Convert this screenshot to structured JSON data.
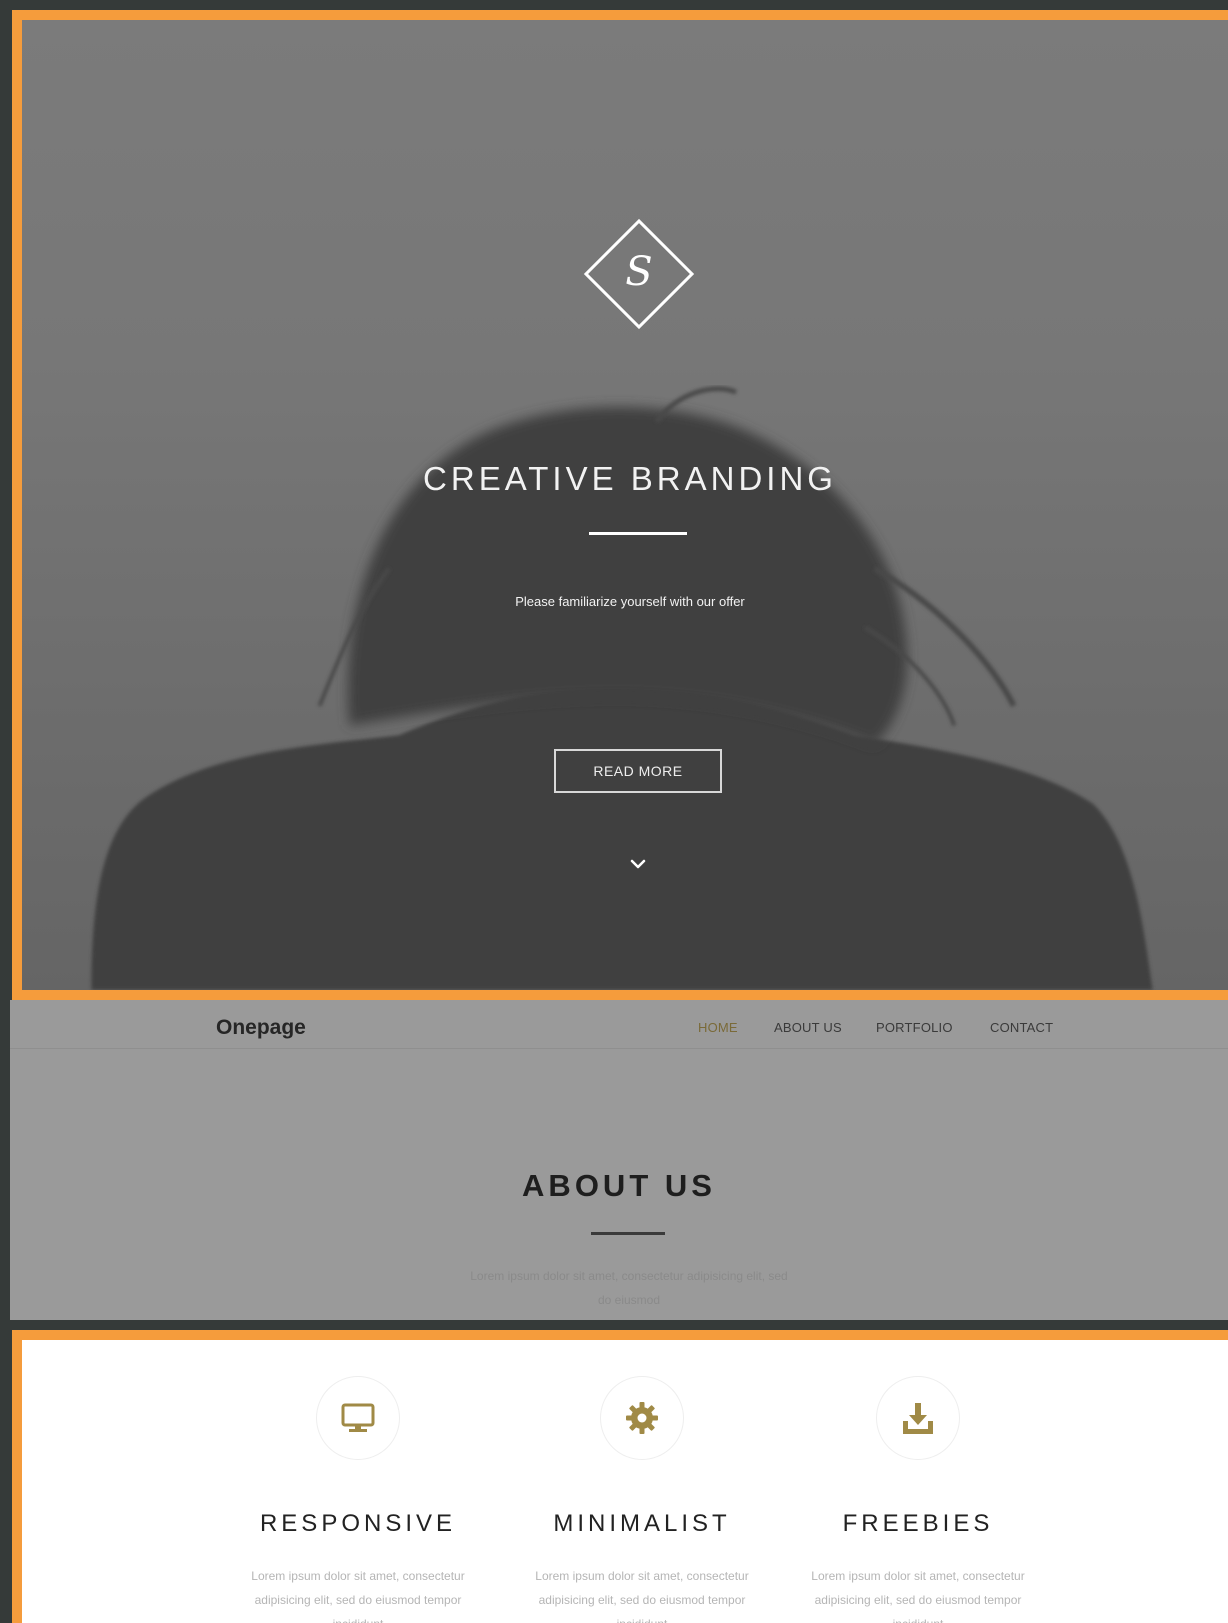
{
  "hero": {
    "logo_glyph": "S",
    "title": "CREATIVE BRANDING",
    "subtitle": "Please familiarize yourself with our offer",
    "cta_label": "READ MORE"
  },
  "nav": {
    "brand": "Onepage",
    "items": [
      {
        "label": "HOME",
        "active": true
      },
      {
        "label": "ABOUT US",
        "active": false
      },
      {
        "label": "PORTFOLIO",
        "active": false
      },
      {
        "label": "CONTACT",
        "active": false
      }
    ]
  },
  "about": {
    "title": "ABOUT US",
    "text": "Lorem ipsum dolor sit amet, consectetur adipisicing elit, sed do eiusmod"
  },
  "features": [
    {
      "icon": "monitor-icon",
      "title": "RESPONSIVE",
      "text": "Lorem ipsum dolor sit amet, consectetur adipisicing elit, sed do eiusmod tempor incididunt"
    },
    {
      "icon": "gear-icon",
      "title": "MINIMALIST",
      "text": "Lorem ipsum dolor sit amet, consectetur adipisicing elit, sed do eiusmod tempor incididunt"
    },
    {
      "icon": "download-icon",
      "title": "FREEBIES",
      "text": "Lorem ipsum dolor sit amet, consectetur adipisicing elit, sed do eiusmod tempor incididunt"
    }
  ],
  "colors": {
    "frame_accent": "#f59c3c",
    "icon_gold": "#a08a46",
    "nav_active": "#7a6a38"
  }
}
